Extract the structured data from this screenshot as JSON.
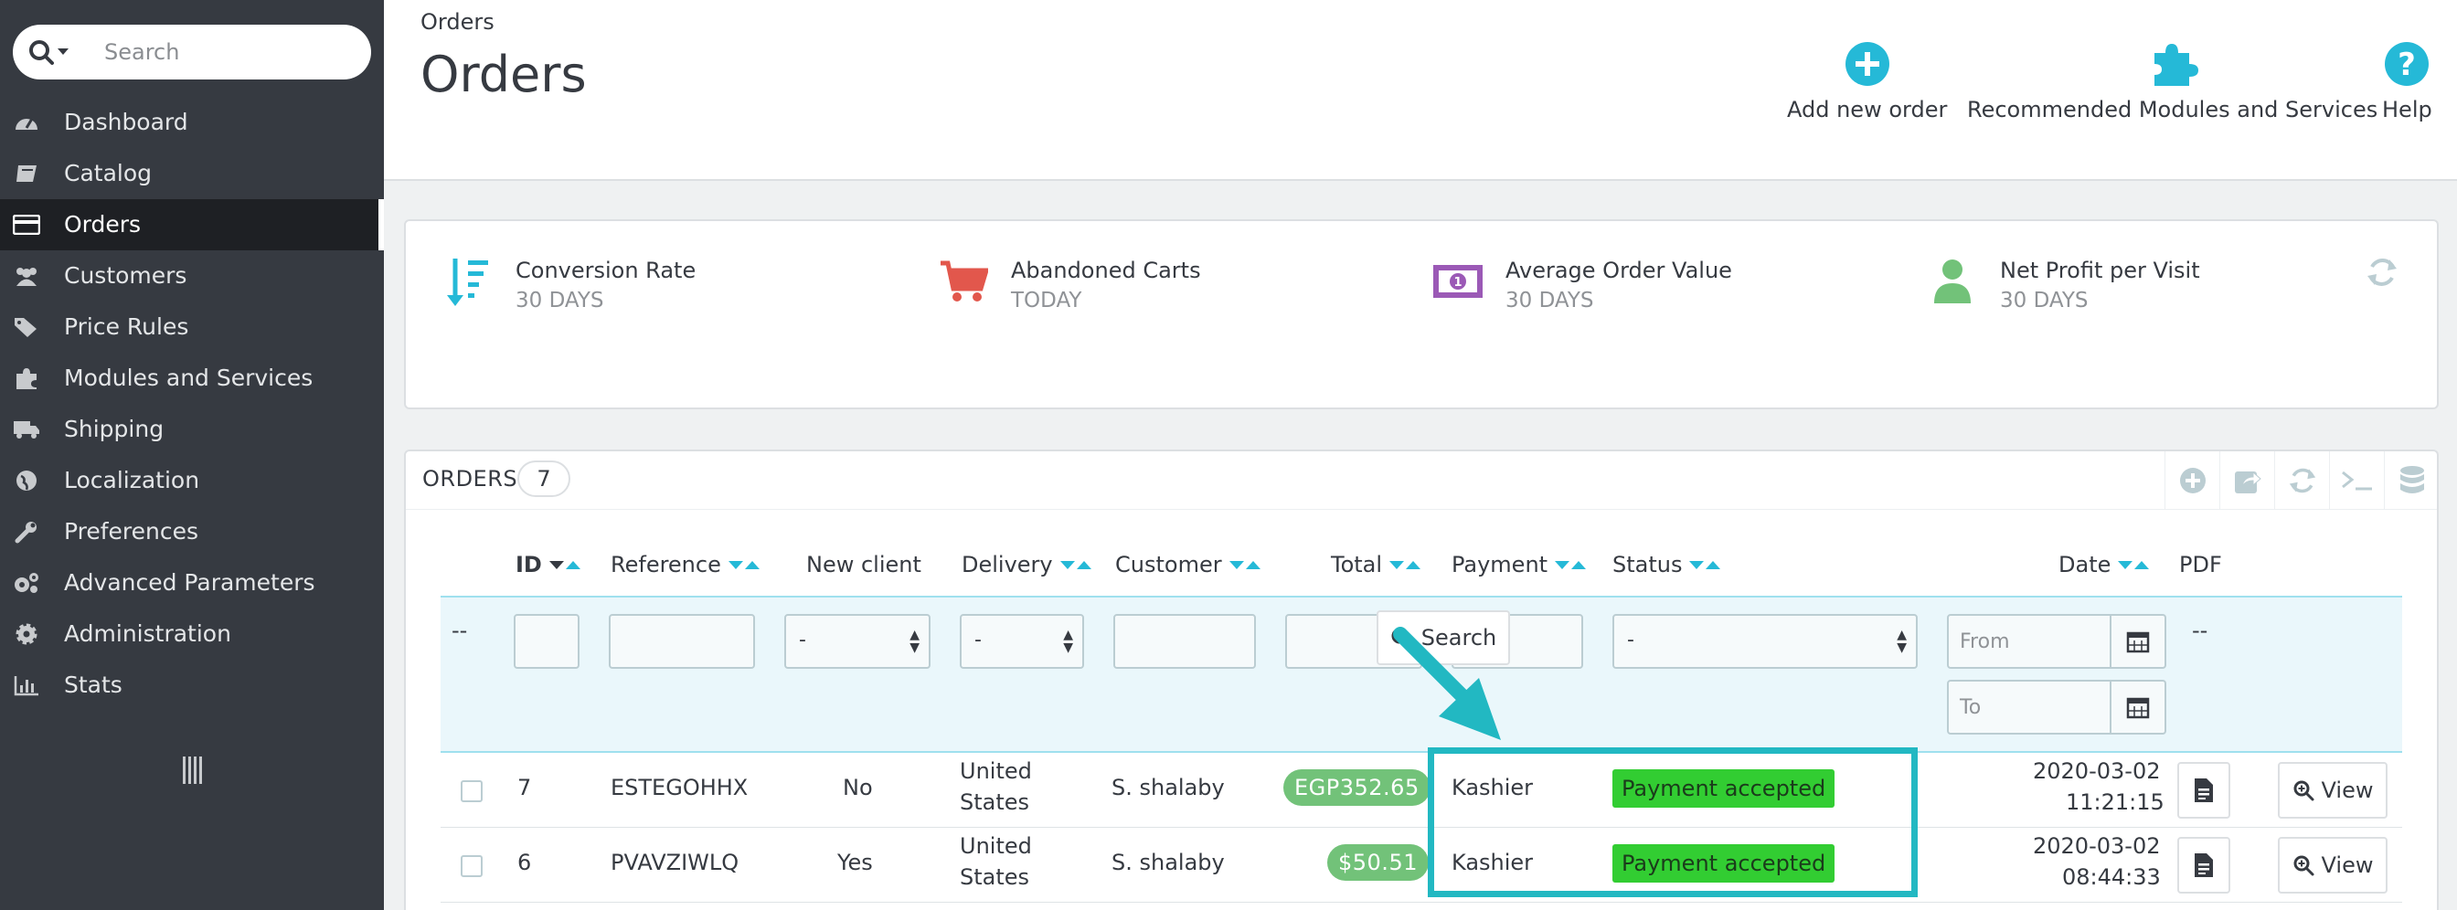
{
  "sidebar": {
    "search_placeholder": "Search",
    "items": [
      {
        "label": "Dashboard",
        "icon": "dashboard-icon"
      },
      {
        "label": "Catalog",
        "icon": "book-icon"
      },
      {
        "label": "Orders",
        "icon": "credit-card-icon",
        "active": true
      },
      {
        "label": "Customers",
        "icon": "users-icon"
      },
      {
        "label": "Price Rules",
        "icon": "tags-icon"
      },
      {
        "label": "Modules and Services",
        "icon": "puzzle-icon"
      },
      {
        "label": "Shipping",
        "icon": "truck-icon"
      },
      {
        "label": "Localization",
        "icon": "globe-icon"
      },
      {
        "label": "Preferences",
        "icon": "wrench-icon"
      },
      {
        "label": "Advanced Parameters",
        "icon": "cogs-icon"
      },
      {
        "label": "Administration",
        "icon": "gear-icon"
      },
      {
        "label": "Stats",
        "icon": "bar-chart-icon"
      }
    ]
  },
  "header": {
    "breadcrumb": "Orders",
    "title": "Orders",
    "toolbar": {
      "add_new_order": "Add new order",
      "recommended_modules": "Recommended Modules and Services",
      "help": "Help"
    }
  },
  "kpis": [
    {
      "title": "Conversion Rate",
      "sub": "30 DAYS",
      "icon": "sort-amount-down-icon",
      "color": "#25b9d7"
    },
    {
      "title": "Abandoned Carts",
      "sub": "TODAY",
      "icon": "shopping-cart-icon",
      "color": "#e2574c"
    },
    {
      "title": "Average Order Value",
      "sub": "30 DAYS",
      "icon": "money-icon",
      "color": "#9b59b6"
    },
    {
      "title": "Net Profit per Visit",
      "sub": "30 DAYS",
      "icon": "user-icon",
      "color": "#72c279"
    }
  ],
  "orders_panel": {
    "title": "ORDERS",
    "count": "7",
    "columns": {
      "id": "ID",
      "reference": "Reference",
      "new_client": "New client",
      "delivery": "Delivery",
      "customer": "Customer",
      "total": "Total",
      "payment": "Payment",
      "status": "Status",
      "date": "Date",
      "pdf": "PDF"
    },
    "filters": {
      "dash": "--",
      "new_client_value": "-",
      "delivery_value": "-",
      "status_value": "-",
      "date_from_placeholder": "From",
      "date_to_placeholder": "To",
      "pdf_dash": "--",
      "search_label": "Search"
    },
    "rows": [
      {
        "id": "7",
        "reference": "ESTEGOHHX",
        "new_client": "No",
        "delivery_line1": "United",
        "delivery_line2": "States",
        "customer": "S. shalaby",
        "total": "EGP352.65",
        "payment": "Kashier",
        "status": "Payment accepted",
        "date_line1": "2020-03-02",
        "date_line2": "11:21:15",
        "view_label": "View"
      },
      {
        "id": "6",
        "reference": "PVAVZIWLQ",
        "new_client": "Yes",
        "delivery_line1": "United",
        "delivery_line2": "States",
        "customer": "S. shalaby",
        "total": "$50.51",
        "payment": "Kashier",
        "status": "Payment accepted",
        "date_line1": "2020-03-02",
        "date_line2": "08:44:33",
        "view_label": "View"
      }
    ]
  },
  "colors": {
    "sidebar_bg": "#363a41",
    "accent": "#25b9d7",
    "status_accepted": "#32cd32",
    "total_badge": "#72c279",
    "annotation": "#22b8c2"
  }
}
